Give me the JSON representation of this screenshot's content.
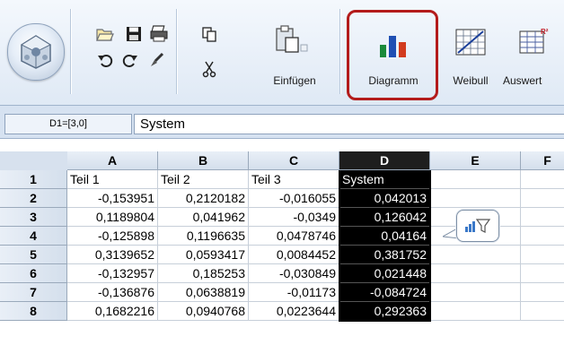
{
  "ribbon": {
    "paste_label": "Einfügen",
    "chart_label": "Diagramm",
    "weibull_label": "Weibull",
    "analysis_label": "Auswert"
  },
  "formula_bar": {
    "name_box": "D1=[3,0]",
    "value": "System"
  },
  "sheet": {
    "columns": [
      "A",
      "B",
      "C",
      "D",
      "E",
      "F"
    ],
    "rows": [
      {
        "row": "1",
        "A": "Teil 1",
        "B": "Teil 2",
        "C": "Teil 3",
        "D": "System"
      },
      {
        "row": "2",
        "A": "-0,153951",
        "B": "0,2120182",
        "C": "-0,016055",
        "D": "0,042013"
      },
      {
        "row": "3",
        "A": "0,1189804",
        "B": "0,041962",
        "C": "-0,0349",
        "D": "0,126042"
      },
      {
        "row": "4",
        "A": "-0,125898",
        "B": "0,1196635",
        "C": "0,0478746",
        "D": "0,04164"
      },
      {
        "row": "5",
        "A": "0,3139652",
        "B": "0,0593417",
        "C": "0,0084452",
        "D": "0,381752"
      },
      {
        "row": "6",
        "A": "-0,132957",
        "B": "0,185253",
        "C": "-0,030849",
        "D": "0,021448"
      },
      {
        "row": "7",
        "A": "-0,136876",
        "B": "0,0638819",
        "C": "-0,01173",
        "D": "-0,084724"
      },
      {
        "row": "8",
        "A": "0,1682216",
        "B": "0,0940768",
        "C": "0,0223644",
        "D": "0,292363"
      }
    ],
    "selected_column": "D"
  },
  "floating_button": {
    "icon": "quick-chart-icon"
  },
  "colors": {
    "highlight": "#b31b1b",
    "selection": "#000000"
  }
}
